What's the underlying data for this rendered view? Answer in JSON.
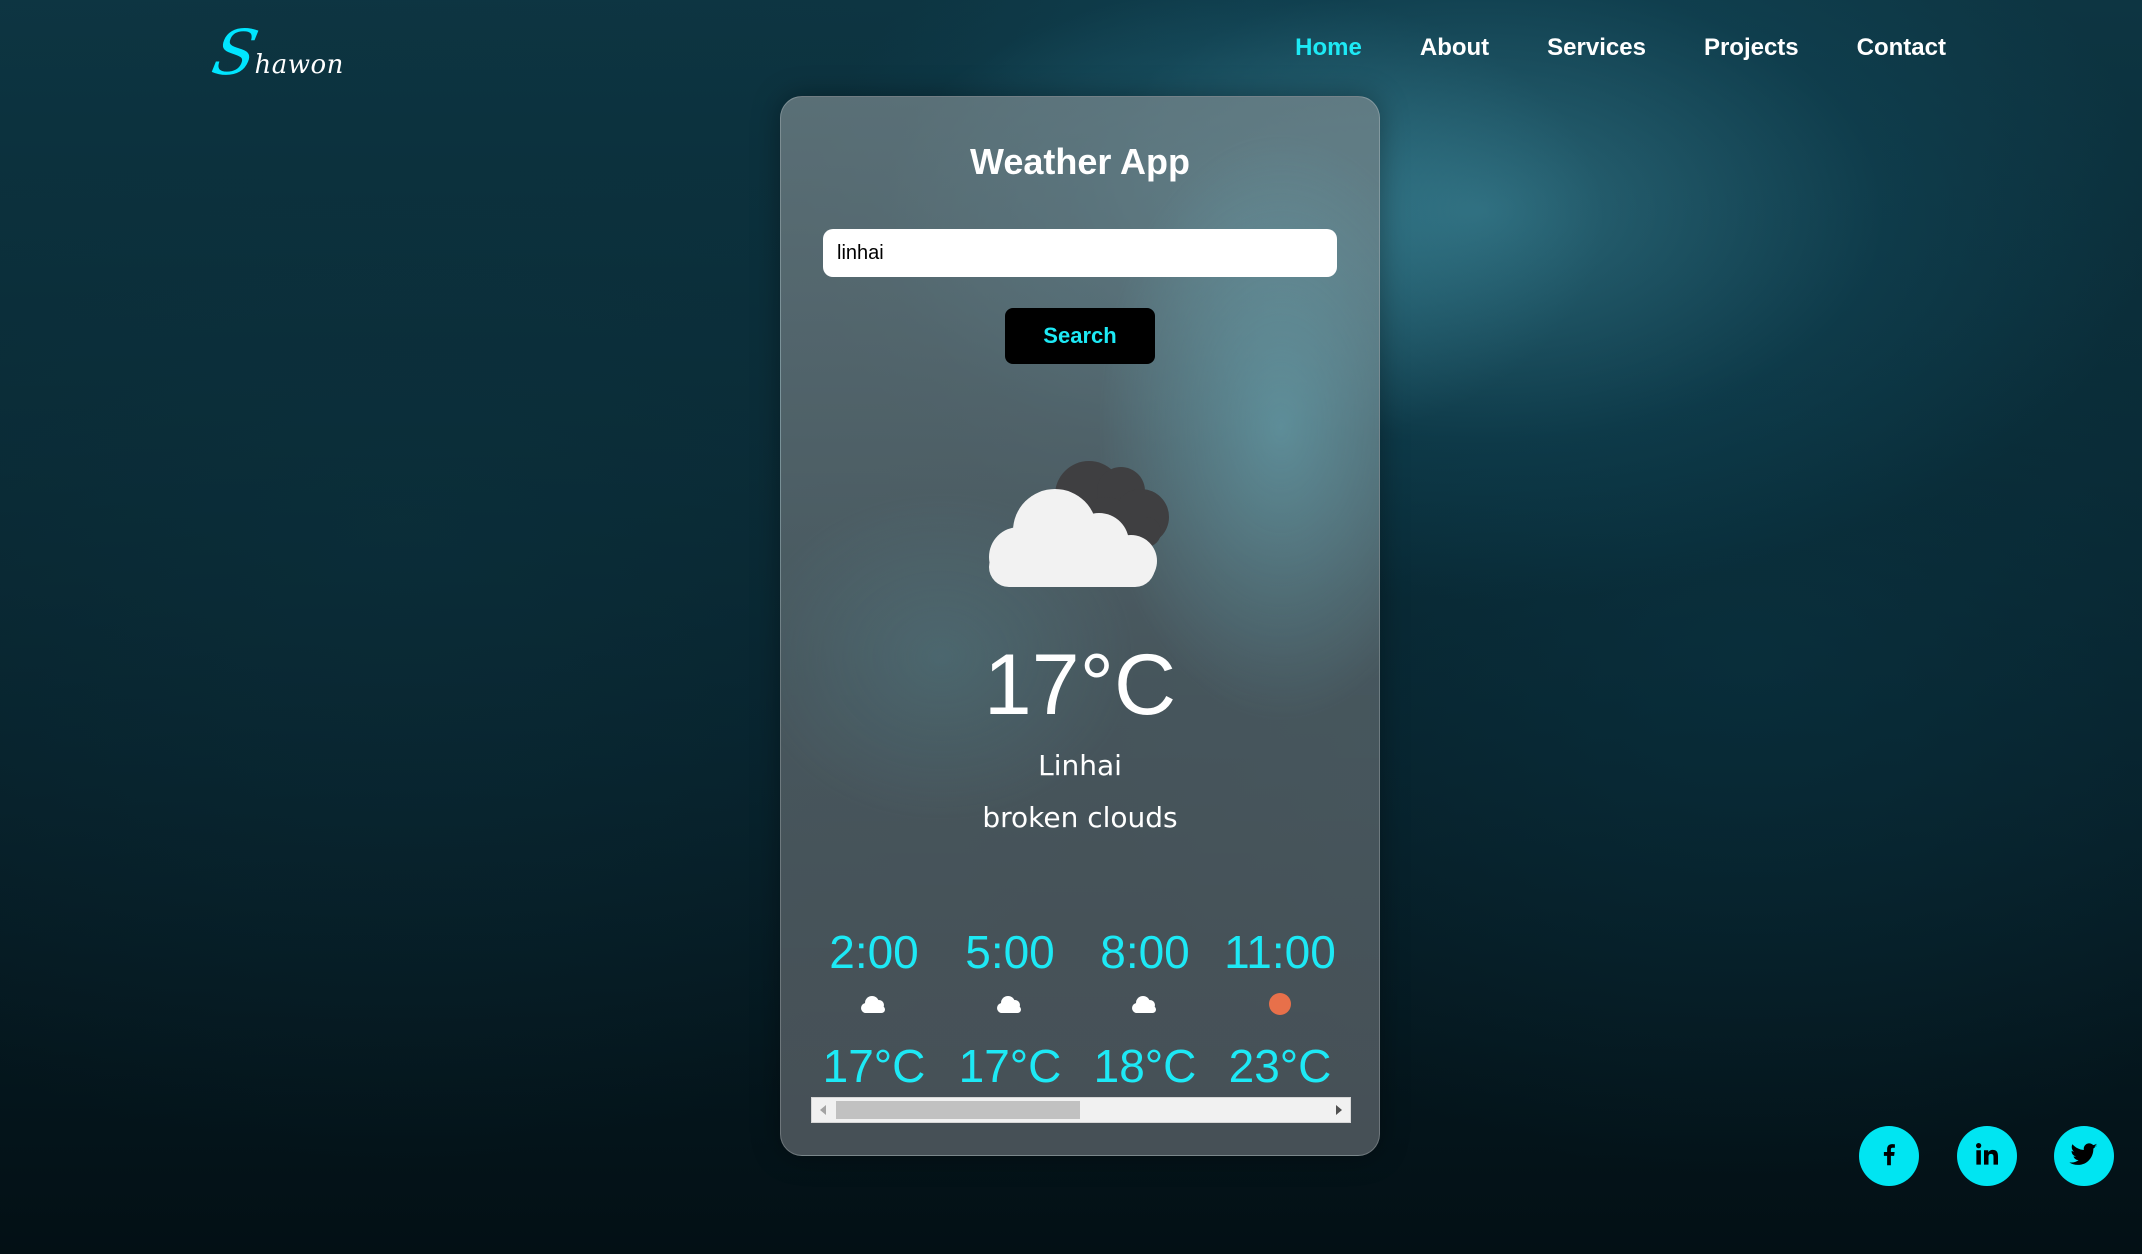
{
  "nav": {
    "logo_first": "S",
    "logo_rest": "hawon",
    "items": [
      {
        "label": "Home",
        "active": true
      },
      {
        "label": "About",
        "active": false
      },
      {
        "label": "Services",
        "active": false
      },
      {
        "label": "Projects",
        "active": false
      },
      {
        "label": "Contact",
        "active": false
      }
    ]
  },
  "weather": {
    "title": "Weather App",
    "search_value": "linhai",
    "search_button": "Search",
    "main_icon": "broken-clouds-icon",
    "temperature": "17°C",
    "city": "Linhai",
    "description": "broken clouds",
    "forecast": [
      {
        "time": "2:00",
        "icon": "cloud-icon",
        "temp": "17°C"
      },
      {
        "time": "5:00",
        "icon": "cloud-icon",
        "temp": "17°C"
      },
      {
        "time": "8:00",
        "icon": "cloud-icon",
        "temp": "18°C"
      },
      {
        "time": "11:00",
        "icon": "sun-icon",
        "temp": "23°C"
      }
    ]
  },
  "social": [
    {
      "name": "facebook",
      "icon": "facebook-icon"
    },
    {
      "name": "linkedin",
      "icon": "linkedin-icon"
    },
    {
      "name": "twitter",
      "icon": "twitter-icon"
    }
  ],
  "colors": {
    "accent": "#1de9f5",
    "social_bg": "#00e5f2",
    "sun": "#e8704a"
  }
}
